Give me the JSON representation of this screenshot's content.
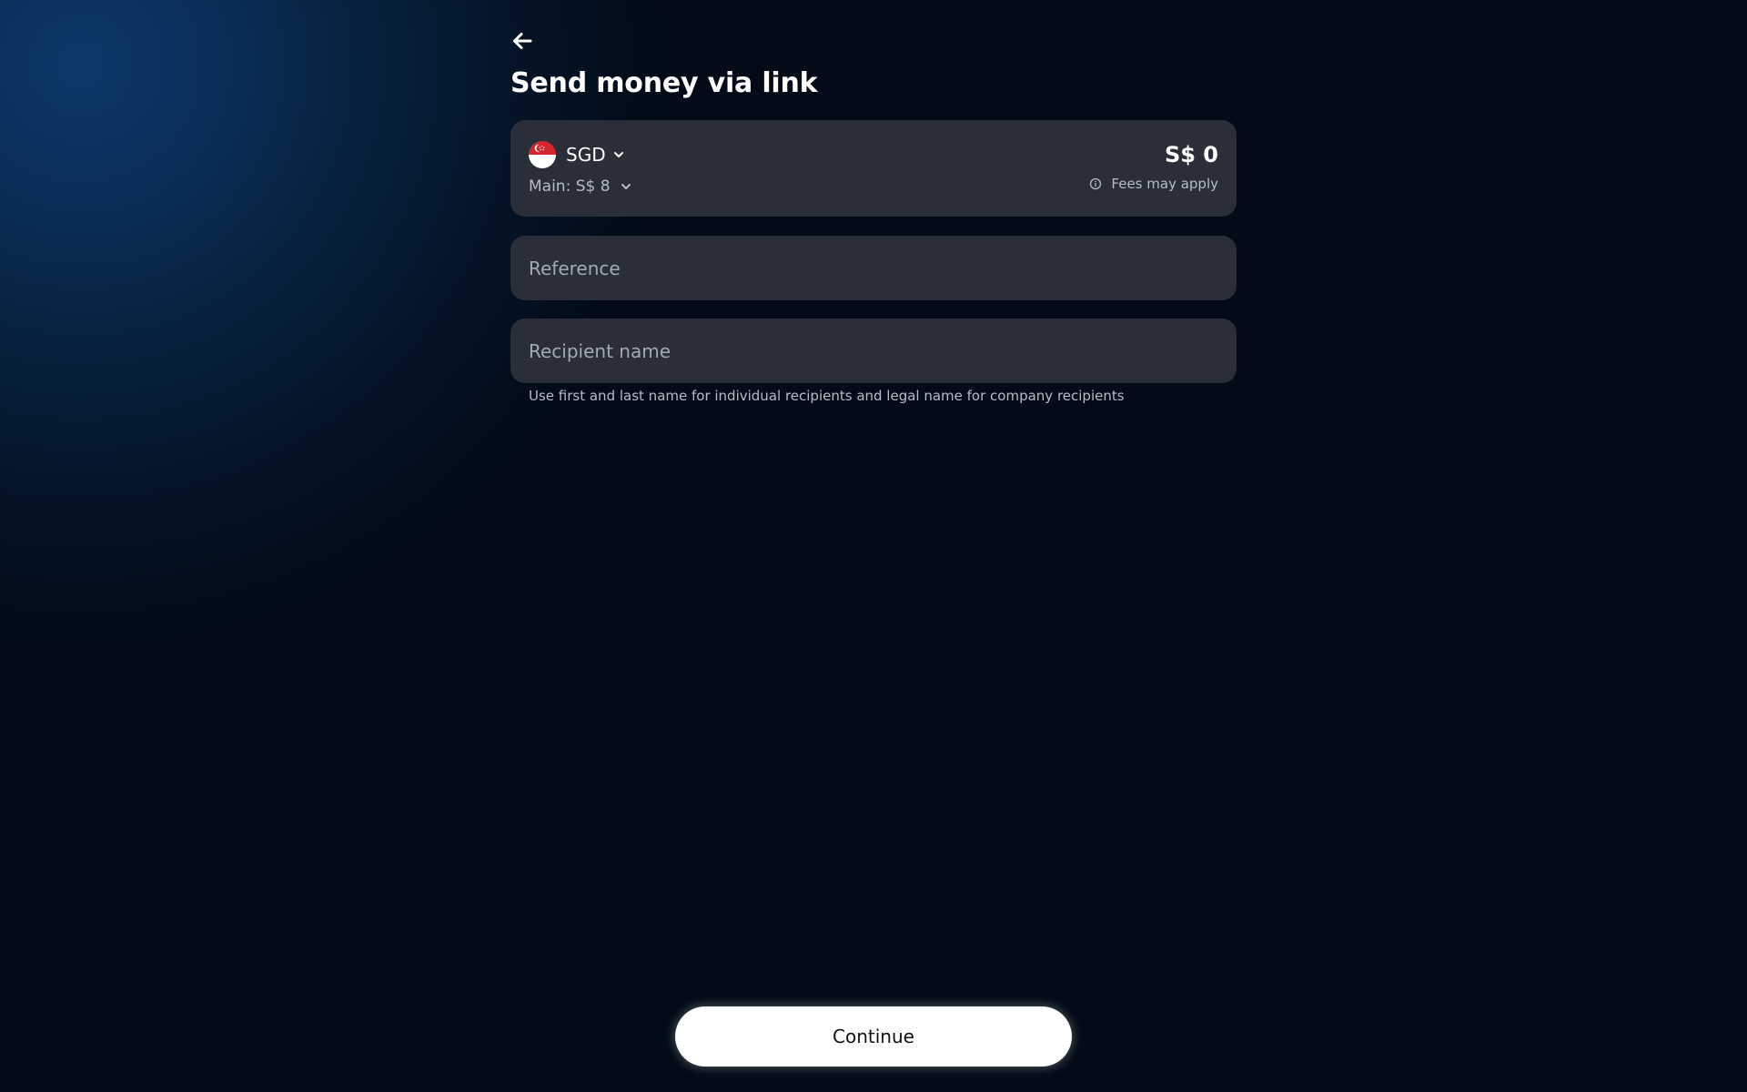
{
  "page": {
    "title": "Send money via link"
  },
  "amount_card": {
    "currency_code": "SGD",
    "currency_flag": "singapore-flag",
    "balance_label": "Main: S$ 8",
    "amount": "S$ 0",
    "fees_label": "Fees may apply"
  },
  "fields": {
    "reference_placeholder": "Reference",
    "recipient_placeholder": "Recipient name",
    "recipient_hint": "Use first and last name for individual recipients and legal name for company recipients"
  },
  "actions": {
    "continue_label": "Continue"
  },
  "icons": {
    "back": "arrow-left-icon",
    "currency_dropdown": "chevron-down-icon",
    "balance_dropdown": "chevron-down-icon",
    "fees_info": "info-icon"
  },
  "colors": {
    "background": "#020b17",
    "card": "#292e38",
    "flag_red": "#d22630",
    "button": "#ffffff"
  }
}
